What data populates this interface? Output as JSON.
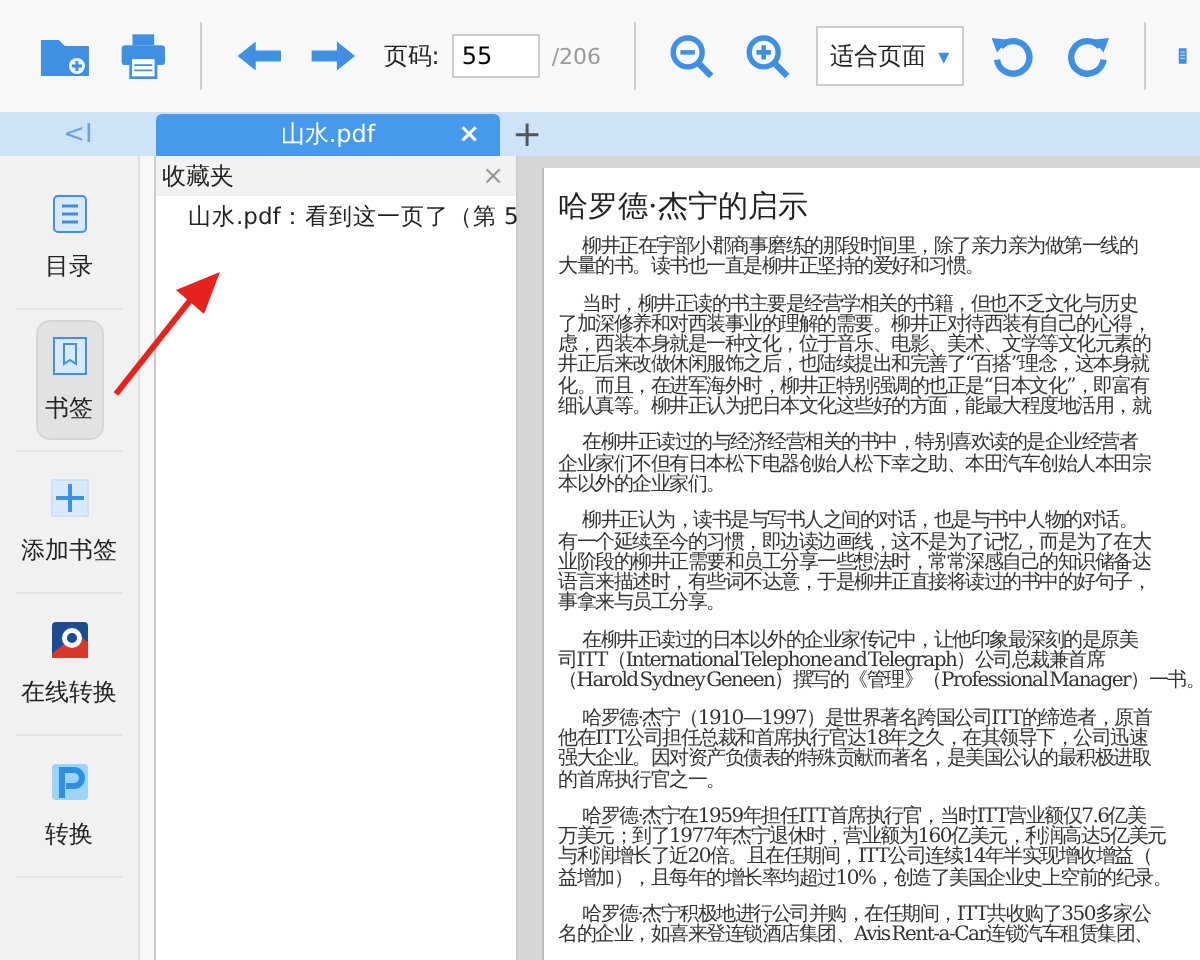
{
  "toolbar": {
    "page_label": "页码:",
    "page_value": "55",
    "page_total": "/206",
    "zoom_mode": "适合页面",
    "dropdown_caret": "▾"
  },
  "tabs": [
    {
      "label": "山水.pdf",
      "close": "×",
      "selected": true
    }
  ],
  "tab_add": "+",
  "collapse": "<I",
  "sidebar": {
    "items": [
      {
        "label": "目录",
        "selected": false
      },
      {
        "label": "书签",
        "selected": true
      },
      {
        "label": "添加书签",
        "selected": false
      },
      {
        "label": "在线转换",
        "selected": false
      },
      {
        "label": "转换",
        "selected": false
      }
    ]
  },
  "bookmarks": {
    "title": "收藏夹",
    "close": "×",
    "items": [
      {
        "label": "山水.pdf：看到这一页了（第 5"
      }
    ]
  },
  "document": {
    "title": "哈罗德·杰宁的启示",
    "paragraphs": [
      {
        "lines": [
          "柳井正在宇部小郡商事磨练的那段时间里，除了亲力亲为做第一线的",
          "大量的书。读书也一直是柳井正坚持的爱好和习惯。"
        ]
      },
      {
        "lines": [
          "当时，柳井正读的书主要是经营学相关的书籍，但也不乏文化与历史",
          "了加深修养和对西装事业的理解的需要。柳井正对待西装有自己的心得，",
          "虑，西装本身就是一种文化，位于音乐、电影、美术、文学等文化元素的",
          "井正后来改做休闲服饰之后，也陆续提出和完善了“百搭”理念，这本身就",
          "化。而且，在进军海外时，柳井正特别强调的也正是“日本文化”，即富有",
          "细认真等。柳井正认为把日本文化这些好的方面，能最大程度地活用，就"
        ]
      },
      {
        "lines": [
          "在柳井正读过的与经济经营相关的书中，特别喜欢读的是企业经营者",
          "企业家们不但有日本松下电器创始人松下幸之助、本田汽车创始人本田宗",
          "本以外的企业家们。"
        ]
      },
      {
        "lines": [
          "柳井正认为，读书是与写书人之间的对话，也是与书中人物的对话。",
          "有一个延续至今的习惯，即边读边画线，这不是为了记忆，而是为了在大",
          "业阶段的柳井正需要和员工分享一些想法时，常常深感自己的知识储备达",
          "语言来描述时，有些词不达意，于是柳井正直接将读过的书中的好句子，",
          "事拿来与员工分享。"
        ]
      },
      {
        "lines": [
          "在柳井正读过的日本以外的企业家传记中，让他印象最深刻的是原美",
          "司ITT（International Telephone and Telegraph）公司总裁兼首席",
          "（Harold Sydney Geneen）撰写的《管理》（Professional Manager）一书。"
        ]
      },
      {
        "lines": [
          "哈罗德·杰宁（1910—1997）是世界著名跨国公司ITT的缔造者，原首",
          "他在ITT公司担任总裁和首席执行官达18年之久，在其领导下，公司迅速",
          "强大企业。因对资产负债表的特殊贡献而著名，是美国公认的最积极进取",
          "的首席执行官之一。"
        ]
      },
      {
        "lines": [
          "哈罗德·杰宁在1959年担任ITT首席执行官，当时ITT营业额仅7.6亿美",
          "万美元；到了1977年杰宁退休时，营业额为160亿美元，利润高达5亿美元",
          "与利润增长了近20倍。且在任期间，ITT公司连续14年半实现增收增益（",
          "益增加），且每年的增长率均超过10%，创造了美国企业史上空前的纪录。"
        ]
      },
      {
        "lines": [
          "哈罗德·杰宁积极地进行公司并购，在任期间，ITT共收购了350多家公",
          "名的企业，如喜来登连锁酒店集团、Avis Rent-a-Car连锁汽车租赁集团、"
        ]
      }
    ]
  }
}
